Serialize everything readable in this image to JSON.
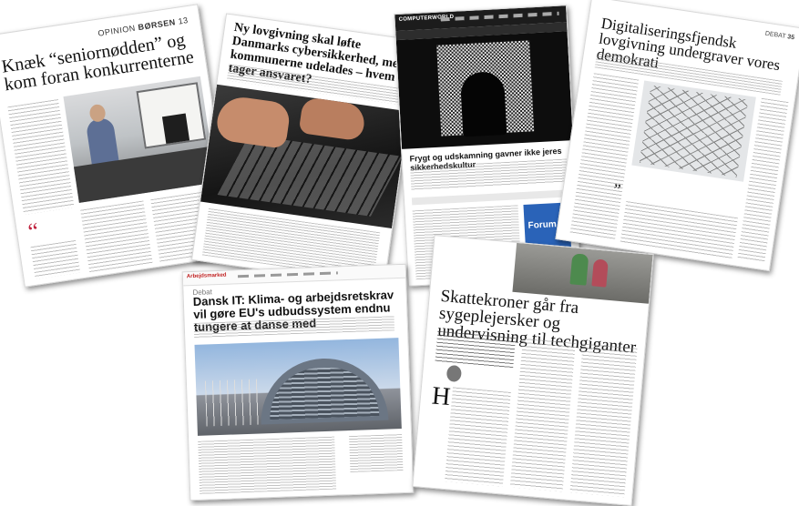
{
  "cards": {
    "borsen": {
      "section": "OPINION",
      "paper": "BØRSEN",
      "page": "13",
      "headline": "Knæk “seniornødden” og kom foran konkurrenterne"
    },
    "kommuner": {
      "headline": "Ny lovgivning skal løfte Danmarks cybersikkerhed, men kommunerne udelades – hvem tager ansvaret?"
    },
    "computerworld": {
      "logo": "COMPUTERWORLD",
      "headline": "Frygt og udskamning gavner ikke jeres sikkerhedskultur",
      "ad_label": "Forum"
    },
    "digitalisering": {
      "section": "DEBAT",
      "page": "35",
      "headline": "Digitaliseringsfjendsk lovgivning undergraver vores demokrati"
    },
    "arbejdsmarked": {
      "logo": "Arbejdsmarked",
      "kicker": "Debat",
      "headline": "Dansk IT: Klima- og arbejdsretskrav vil gøre EU's udbudssystem endnu tungere at danse med"
    },
    "skattekroner": {
      "headline": "Skattekroner går fra sygeplejersker og undervisning til techgiganter",
      "drop_cap": "H"
    }
  },
  "icons": {
    "quote_mark": "“",
    "quote_mark_small": "”"
  }
}
